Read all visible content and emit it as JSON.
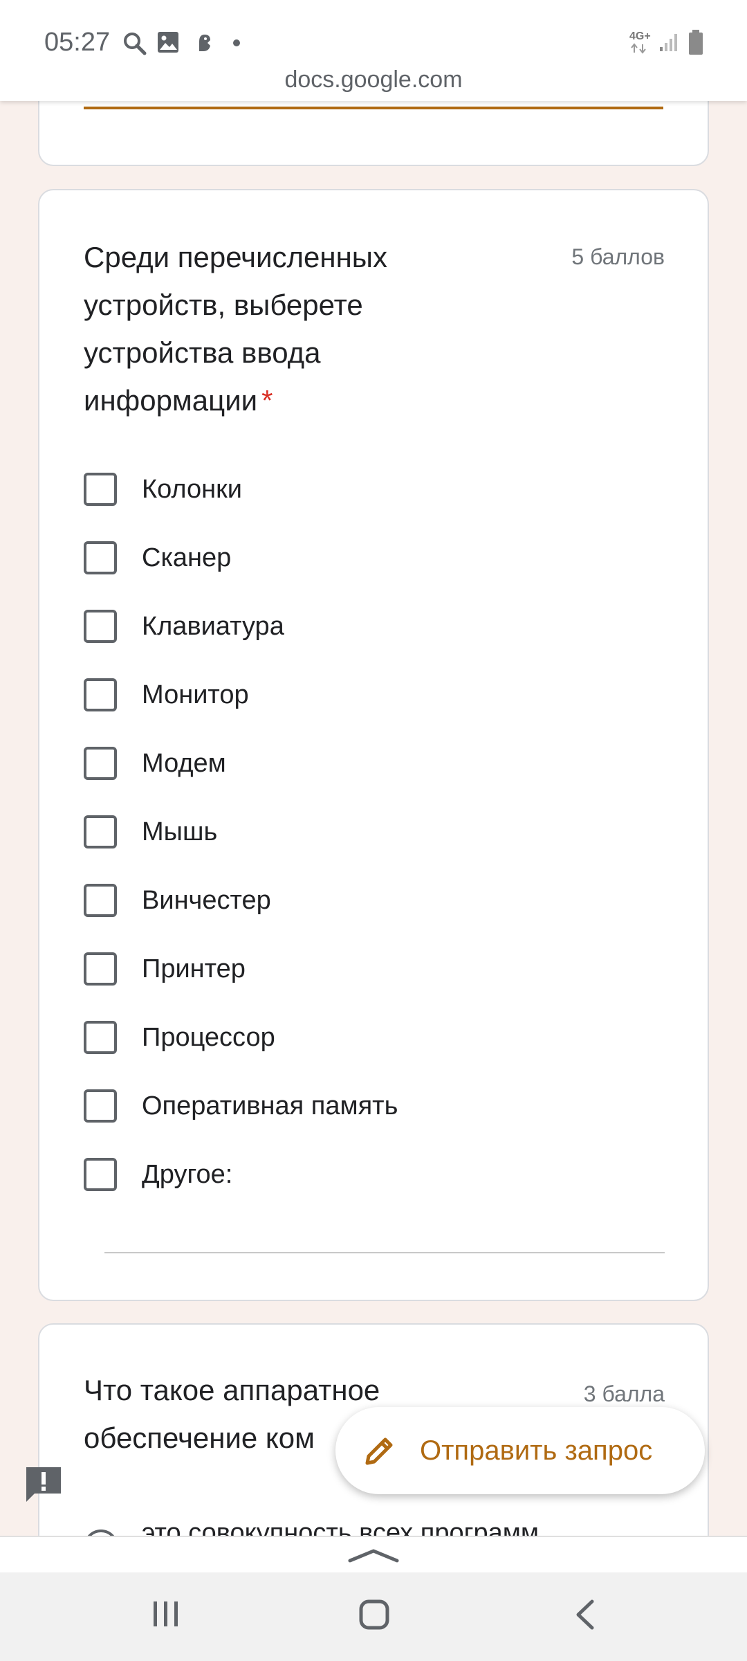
{
  "status_bar": {
    "time": "05:27",
    "network": "4G+"
  },
  "browser": {
    "url": "docs.google.com"
  },
  "question1": {
    "title": "Среди перечисленных устройств, выберете устройства ввода информации",
    "required_mark": "*",
    "points": "5 баллов",
    "options": [
      "Колонки",
      "Сканер",
      "Клавиатура",
      "Монитор",
      "Модем",
      "Мышь",
      "Винчестер",
      "Принтер",
      "Процессор",
      "Оперативная память",
      "Другое:"
    ]
  },
  "question2": {
    "title": "Что такое аппаратное обеспечение ком",
    "points": "3 балла",
    "first_option": "это совокупность всех программ"
  },
  "fab": {
    "label": "Отправить запрос"
  },
  "colors": {
    "accent": "#b06a12",
    "required": "#d93025",
    "page_bg": "#f9f0ec"
  },
  "icons": [
    "search-icon",
    "image-icon",
    "app-icon",
    "dot-icon",
    "signal-icon",
    "battery-icon",
    "pencil-icon",
    "feedback-icon",
    "chevron-up-icon",
    "recent-apps-icon",
    "home-icon",
    "back-icon"
  ]
}
